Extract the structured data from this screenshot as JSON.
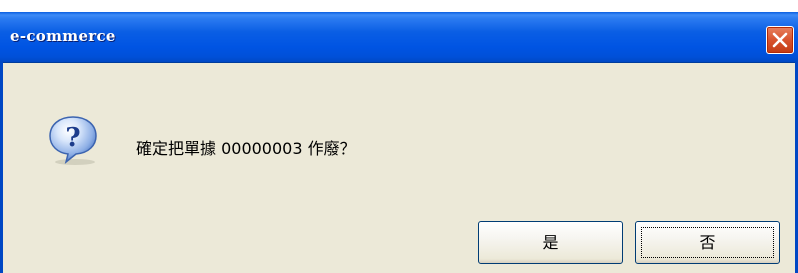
{
  "window": {
    "title": "e-commerce",
    "close_icon": "close-icon"
  },
  "dialog": {
    "icon": "question-icon",
    "message": "確定把單據 00000003 作廢？",
    "buttons": {
      "yes_label": "是",
      "no_label": "否"
    },
    "focused_button": "no"
  },
  "colors": {
    "titlebar": "#0054e3",
    "body": "#ece9d8",
    "close_button": "#d8532e",
    "button_border": "#003c74"
  }
}
